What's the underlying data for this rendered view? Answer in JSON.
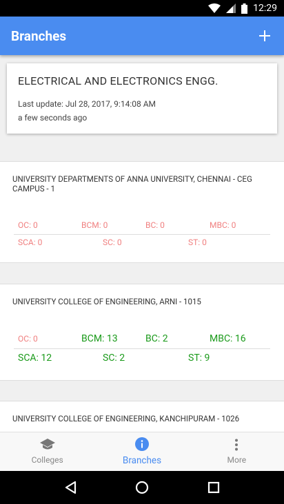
{
  "status_bar": {
    "time": "12:29"
  },
  "app_bar": {
    "title": "Branches",
    "add_label": "+"
  },
  "branch": {
    "name": "ELECTRICAL AND ELECTRONICS ENGG.",
    "last_update": "Last update: Jul 28, 2017, 9:14:08 AM",
    "relative_time": "a few seconds ago"
  },
  "colleges": [
    {
      "name": "UNIVERSITY DEPARTMENTS OF ANNA UNIVERSITY, CHENNAI - CEG CAMPUS - 1",
      "seats_row1": [
        "OC: 0",
        "BCM: 0",
        "BC: 0",
        "MBC: 0"
      ],
      "seats_row2": [
        "SCA: 0",
        "SC: 0",
        "ST: 0"
      ]
    },
    {
      "name": "UNIVERSITY COLLEGE OF ENGINEERING, ARNI - 1015",
      "seats_row1": [
        "OC: 0",
        "BCM: 13",
        "BC: 2",
        "MBC: 16"
      ],
      "seats_row2": [
        "SCA: 12",
        "SC: 2",
        "ST: 9"
      ]
    },
    {
      "name": "UNIVERSITY COLLEGE OF ENGINEERING, KANCHIPURAM - 1026"
    }
  ],
  "bottom_nav": [
    {
      "label": "Colleges",
      "icon": "school-icon",
      "active": false
    },
    {
      "label": "Branches",
      "icon": "info-icon",
      "active": true
    },
    {
      "label": "More",
      "icon": "more-vert-icon",
      "active": false
    }
  ],
  "colors": {
    "primary": "#4a8cf0",
    "zero_seats": "#f08080",
    "available_seats": "#1a9a1a"
  }
}
